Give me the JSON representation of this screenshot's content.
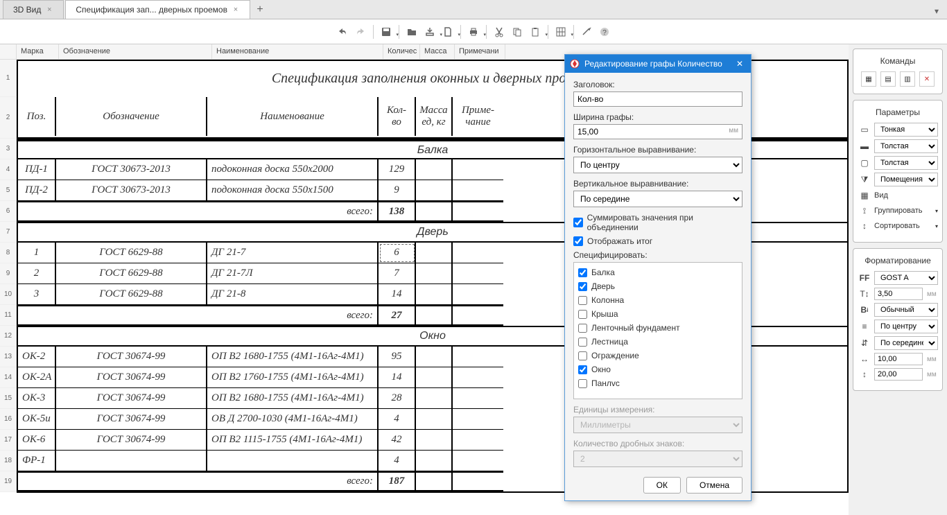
{
  "tabs": {
    "t1": "3D Вид",
    "t2": "Спецификация зап... дверных проемов"
  },
  "colheaders": {
    "mark": "Марка",
    "obozn": "Обозначение",
    "naim": "Наименование",
    "kol": "Количес",
    "massa": "Масса",
    "prim": "Примечани"
  },
  "doc": {
    "title": "Спецификация заполнения оконных и дверных проемов",
    "head": {
      "poz": "Поз.",
      "obozn": "Обозначение",
      "naim": "Наименование",
      "kol": "Кол-во",
      "massa": "Масса ед, кг",
      "prim": "Приме-чание"
    },
    "total_label": "всего:",
    "sec1": "Балка",
    "r1": {
      "poz": "ПД-1",
      "ob": "ГОСТ 30673-2013",
      "nm": "подоконная доска 550х2000",
      "k": "129"
    },
    "r2": {
      "poz": "ПД-2",
      "ob": "ГОСТ 30673-2013",
      "nm": "подоконная доска 550х1500",
      "k": "9"
    },
    "t1": "138",
    "sec2": "Дверь",
    "r3": {
      "poz": "1",
      "ob": "ГОСТ 6629-88",
      "nm": "ДГ 21-7",
      "k": "6"
    },
    "r4": {
      "poz": "2",
      "ob": "ГОСТ 6629-88",
      "nm": "ДГ 21-7Л",
      "k": "7"
    },
    "r5": {
      "poz": "3",
      "ob": "ГОСТ 6629-88",
      "nm": "ДГ 21-8",
      "k": "14"
    },
    "t2": "27",
    "sec3": "Окно",
    "r6": {
      "poz": "ОК-2",
      "ob": "ГОСТ 30674-99",
      "nm": "ОП В2 1680-1755 (4М1-16Аг-4М1)",
      "k": "95"
    },
    "r7": {
      "poz": "ОК-2А",
      "ob": "ГОСТ 30674-99",
      "nm": "ОП В2 1760-1755 (4М1-16Аг-4М1)",
      "k": "14"
    },
    "r8": {
      "poz": "ОК-3",
      "ob": "ГОСТ 30674-99",
      "nm": "ОП В2 1680-1755 (4М1-16Аг-4М1)",
      "k": "28"
    },
    "r9": {
      "poz": "ОК-5и",
      "ob": "ГОСТ 30674-99",
      "nm": "ОВ Д 2700-1030 (4М1-16Аг-4М1)",
      "k": "4"
    },
    "r10": {
      "poz": "ОК-6",
      "ob": "ГОСТ 30674-99",
      "nm": "ОП В2 1115-1755 (4М1-16Аг-4М1)",
      "k": "42"
    },
    "r11": {
      "poz": "ФР-1",
      "ob": "",
      "nm": "",
      "k": "4"
    },
    "t3": "187"
  },
  "dialog": {
    "title": "Редактирование графы Количество",
    "header_label": "Заголовок:",
    "header_value": "Кол-во",
    "width_label": "Ширина графы:",
    "width_value": "15,00",
    "width_unit": "мм",
    "halign_label": "Горизонтальное выравнивание:",
    "halign_value": "По центру",
    "valign_label": "Вертикальное выравнивание:",
    "valign_value": "По середине",
    "sum_label": "Суммировать значения при объединении",
    "show_total_label": "Отображать итог",
    "spec_label": "Специфицировать:",
    "list": {
      "i1": "Балка",
      "i2": "Дверь",
      "i3": "Колонна",
      "i4": "Крыша",
      "i5": "Ленточный фундамент",
      "i6": "Лестница",
      "i7": "Ограждение",
      "i8": "Окно",
      "i9": "Панлvс"
    },
    "units_label": "Единицы измерения:",
    "units_value": "Миллиметры",
    "decimals_label": "Количество дробных знаков:",
    "decimals_value": "2",
    "ok": "ОК",
    "cancel": "Отмена"
  },
  "panels": {
    "commands": "Команды",
    "params": "Параметры",
    "p_thin": "Тонкая",
    "p_thick": "Толстая",
    "p_thick2": "Толстая",
    "p_rooms": "Помещения",
    "p_view": "Вид",
    "p_group": "Группировать",
    "p_sort": "Сортировать",
    "format": "Форматирование",
    "font": "GOST A",
    "size": "3,50",
    "size_unit": "мм",
    "weight": "Обычный",
    "halign": "По центру",
    "valign": "По середине",
    "v1": "10,00",
    "v2": "20,00",
    "mm": "мм"
  }
}
